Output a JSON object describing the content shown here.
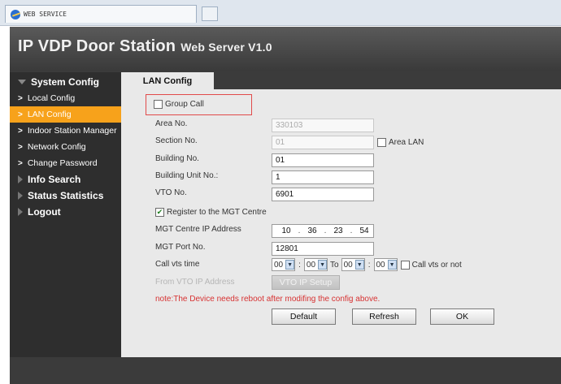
{
  "browser": {
    "tab_title": "WEB SERVICE"
  },
  "header": {
    "title_main": "IP VDP Door Station",
    "title_sub": "Web Server V1.0"
  },
  "sidebar": {
    "system_config": "System Config",
    "items": [
      {
        "label": "Local Config"
      },
      {
        "label": "LAN Config"
      },
      {
        "label": "Indoor Station Manager"
      },
      {
        "label": "Network Config"
      },
      {
        "label": "Change Password"
      }
    ],
    "info_search": "Info Search",
    "status_statistics": "Status Statistics",
    "logout": "Logout"
  },
  "panel": {
    "tab_label": "LAN Config",
    "group_call": {
      "label": "Group Call",
      "checked": false
    },
    "area_no": {
      "label": "Area No.",
      "value": "330103"
    },
    "section_no": {
      "label": "Section No.",
      "value": "01"
    },
    "area_lan": {
      "label": "Area LAN",
      "checked": false
    },
    "building_no": {
      "label": "Building No.",
      "value": "01"
    },
    "building_unit_no": {
      "label": "Building Unit No.:",
      "value": "1"
    },
    "vto_no": {
      "label": "VTO No.",
      "value": "6901"
    },
    "register_mgt": {
      "label": "Register to the MGT Centre",
      "checked": true
    },
    "mgt_ip": {
      "label": "MGT Centre IP Address",
      "octets": [
        "10",
        "36",
        "23",
        "54"
      ]
    },
    "mgt_port": {
      "label": "MGT Port No.",
      "value": "12801"
    },
    "call_vts_time": {
      "label": "Call vts time",
      "start_h": "00",
      "start_m": "00",
      "to_label": "To",
      "end_h": "00",
      "end_m": "00",
      "separator": ":",
      "call_vts_or_not": "Call vts or not"
    },
    "from_vto_ip": {
      "label": "From VTO IP Address",
      "button": "VTO IP Setup"
    },
    "note": "note:The Device needs reboot after modifing the config above.",
    "buttons": {
      "default": "Default",
      "refresh": "Refresh",
      "ok": "OK"
    }
  },
  "colors": {
    "accent": "#f7a21b",
    "note": "#d73232",
    "highlight": "#e14a4a"
  }
}
